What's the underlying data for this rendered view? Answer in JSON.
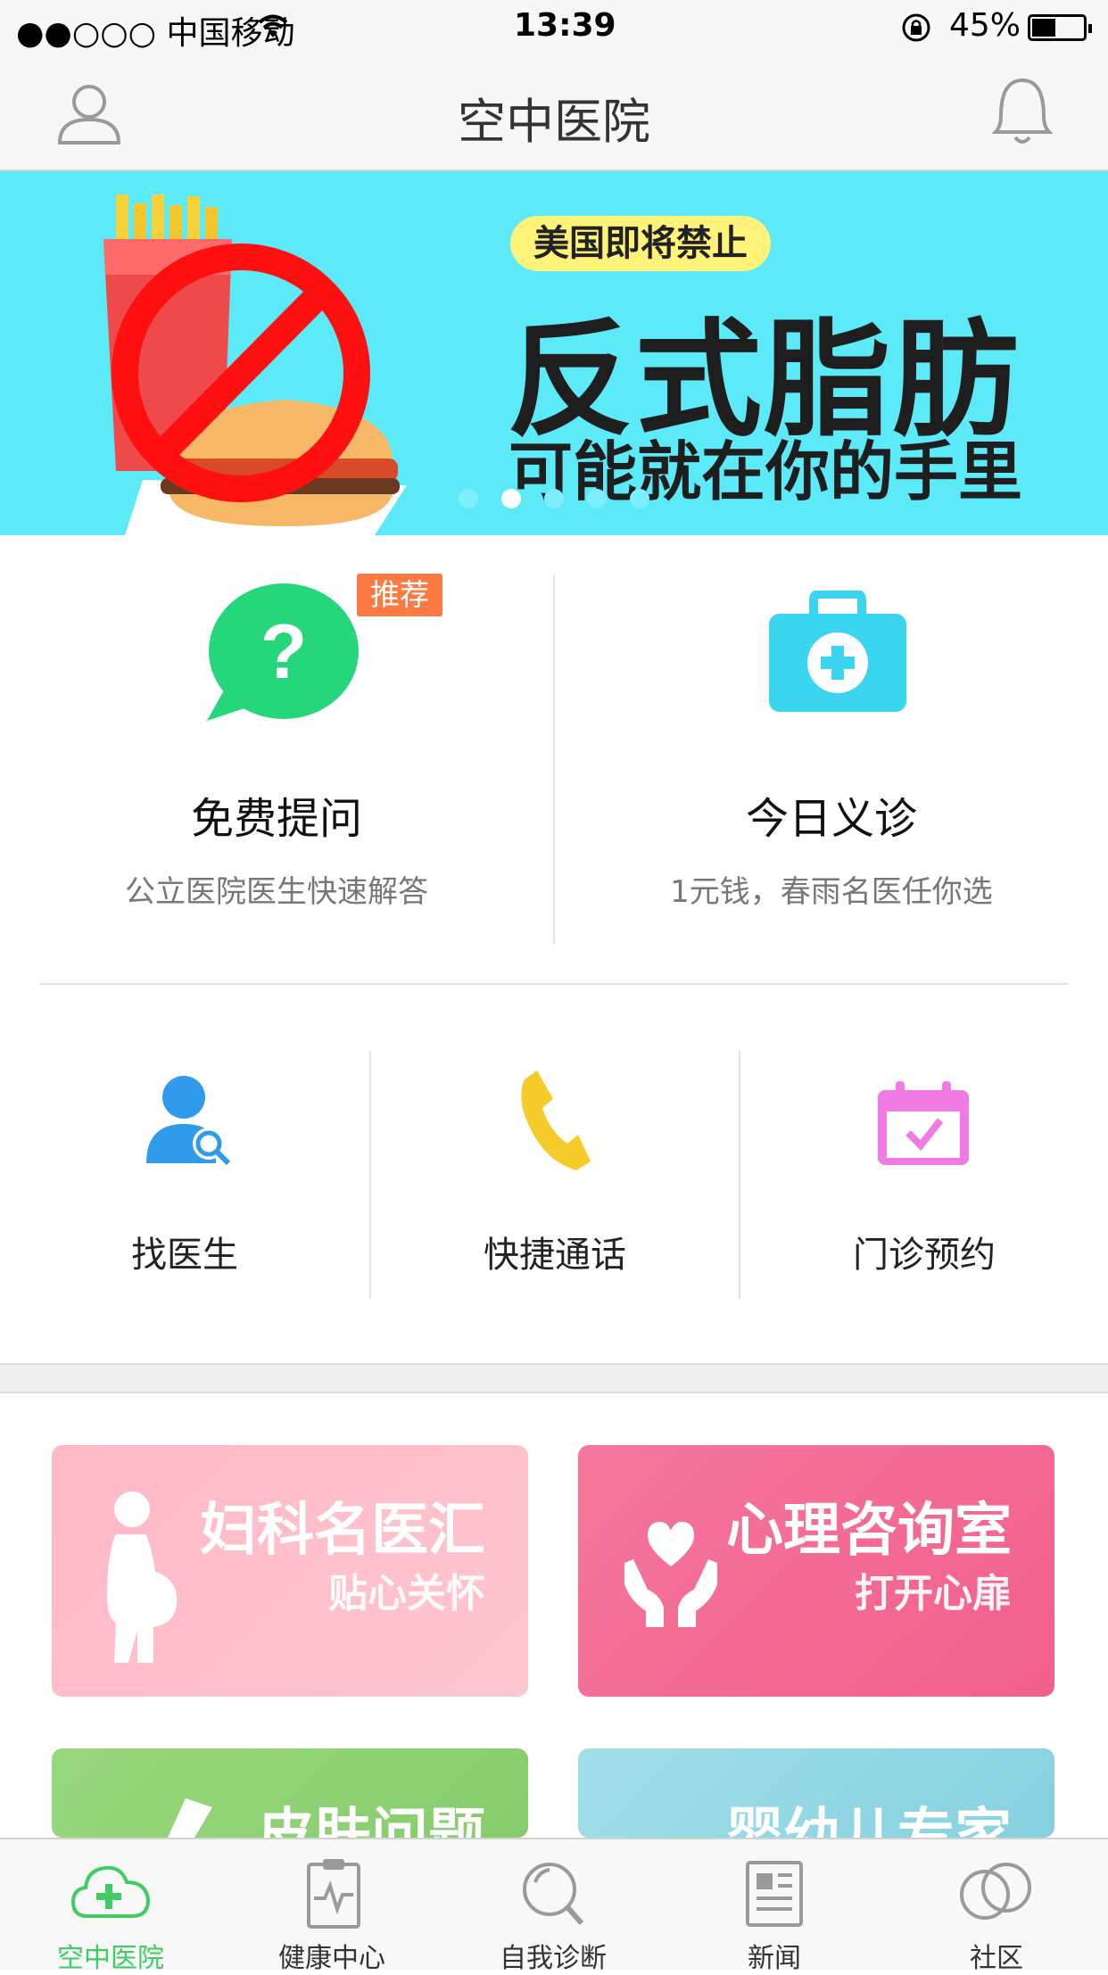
{
  "status_bar": {
    "carrier": "●●○○○ 中国移动",
    "time": "13:39",
    "battery": "45%"
  },
  "header": {
    "title": "空中医院"
  },
  "banner": {
    "tag": "美国即将禁止",
    "headline": "反式脂肪",
    "subline": "可能就在你的手里",
    "page_count": 5,
    "active_page": 2
  },
  "features": [
    {
      "title": "免费提问",
      "desc": "公立医院医生快速解答",
      "badge": "推荐",
      "icon": "question-bubble-icon"
    },
    {
      "title": "今日义诊",
      "desc": "1元钱，春雨名医任你选",
      "icon": "medical-kit-icon"
    }
  ],
  "tools": [
    {
      "label": "找医生",
      "icon": "doctor-search-icon"
    },
    {
      "label": "快捷通话",
      "icon": "phone-icon"
    },
    {
      "label": "门诊预约",
      "icon": "calendar-check-icon"
    }
  ],
  "specialties": [
    {
      "title": "妇科名医汇",
      "subtitle": "贴心关怀",
      "color": "#ffb3bf"
    },
    {
      "title": "心理咨询室",
      "subtitle": "打开心扉",
      "color": "#f56a95"
    },
    {
      "title": "皮肤问题",
      "subtitle": "",
      "color": "#8fd47a"
    },
    {
      "title": "婴幼儿专家",
      "subtitle": "",
      "color": "#8fd8e6"
    }
  ],
  "tabbar": {
    "active_color": "#3fcc63",
    "items": [
      {
        "label": "空中医院",
        "icon": "cloud-plus-icon",
        "active": true
      },
      {
        "label": "健康中心",
        "icon": "clipboard-pulse-icon",
        "active": false
      },
      {
        "label": "自我诊断",
        "icon": "magnifier-icon",
        "active": false
      },
      {
        "label": "新闻",
        "icon": "newspaper-icon",
        "active": false
      },
      {
        "label": "社区",
        "icon": "community-rings-icon",
        "active": false
      }
    ]
  }
}
